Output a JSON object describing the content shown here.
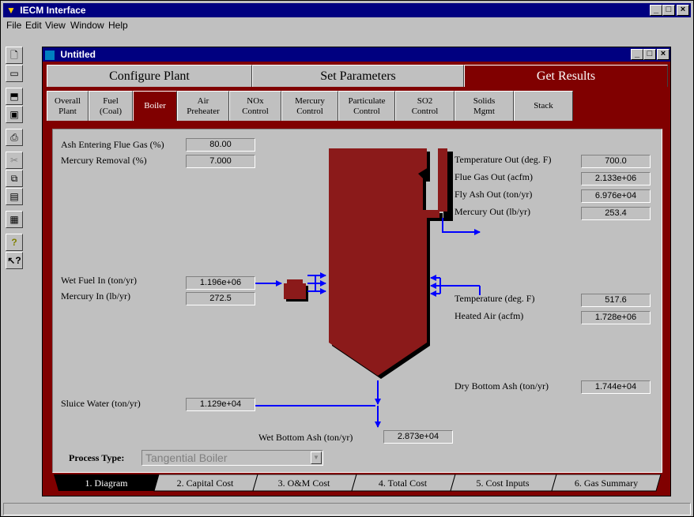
{
  "app": {
    "title": "IECM Interface",
    "menu": [
      "File",
      "Edit",
      "View",
      "Window",
      "Help"
    ]
  },
  "toolbar": [
    "new-icon",
    "open-icon",
    "import-icon",
    "save-icon",
    "print-icon",
    "cut-icon",
    "copy-icon",
    "paste-icon",
    "properties-icon",
    "help-icon",
    "context-help-icon"
  ],
  "doc": {
    "title": "Untitled",
    "main_tabs": [
      "Configure Plant",
      "Set Parameters",
      "Get Results"
    ],
    "sub_tabs": [
      [
        "Overall",
        "Plant"
      ],
      [
        "Fuel",
        "(Coal)"
      ],
      [
        "Boiler",
        ""
      ],
      [
        "Air",
        "Preheater"
      ],
      [
        "NOx",
        "Control"
      ],
      [
        "Mercury",
        "Control"
      ],
      [
        "Particulate",
        "Control"
      ],
      [
        "SO2",
        "Control"
      ],
      [
        "Solids",
        "Mgmt"
      ],
      [
        "Stack",
        ""
      ]
    ]
  },
  "fields": {
    "ash_entering_label": "Ash Entering Flue Gas (%)",
    "ash_entering": "80.00",
    "mercury_removal_label": "Mercury Removal (%)",
    "mercury_removal": "7.000",
    "temp_out_label": "Temperature Out (deg. F)",
    "temp_out": "700.0",
    "flue_gas_out_label": "Flue Gas Out (acfm)",
    "flue_gas_out": "2.133e+06",
    "fly_ash_out_label": "Fly Ash Out (ton/yr)",
    "fly_ash_out": "6.976e+04",
    "mercury_out_label": "Mercury Out (lb/yr)",
    "mercury_out": "253.4",
    "wet_fuel_in_label": "Wet Fuel In (ton/yr)",
    "wet_fuel_in": "1.196e+06",
    "mercury_in_label": "Mercury In (lb/yr)",
    "mercury_in": "272.5",
    "temperature_label": "Temperature (deg. F)",
    "temperature": "517.6",
    "heated_air_label": "Heated Air (acfm)",
    "heated_air": "1.728e+06",
    "dry_bottom_ash_label": "Dry Bottom Ash (ton/yr)",
    "dry_bottom_ash": "1.744e+04",
    "sluice_water_label": "Sluice Water (ton/yr)",
    "sluice_water": "1.129e+04",
    "wet_bottom_ash_label": "Wet Bottom Ash (ton/yr)",
    "wet_bottom_ash": "2.873e+04"
  },
  "process_type": {
    "label": "Process Type:",
    "value": "Tangential Boiler"
  },
  "bottom_tabs": [
    "1. Diagram",
    "2. Capital Cost",
    "3. O&M Cost",
    "4. Total Cost",
    "5. Cost Inputs",
    "6. Gas Summary"
  ],
  "colors": {
    "maroon": "#800000",
    "boiler": "#8b1a1a",
    "panel": "#c0c0c0",
    "title": "#000080",
    "arrow": "#0000ff"
  }
}
